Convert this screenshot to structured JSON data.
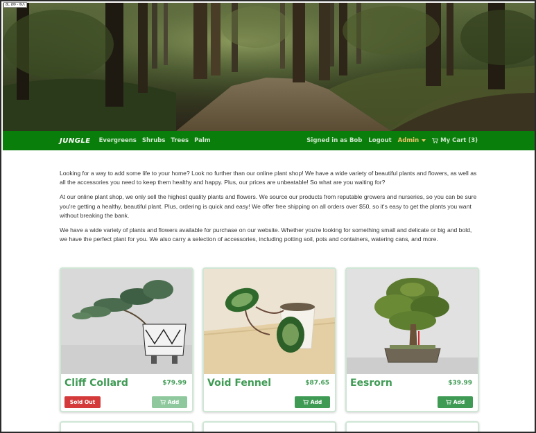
{
  "corner_tag": "ᏰᏞ ᏰᏫ - ᏫᏁ",
  "navbar": {
    "brand": "JUNGLE",
    "links": [
      "Evergreens",
      "Shrubs",
      "Trees",
      "Palm"
    ],
    "signed_in": "Signed in as Bob",
    "logout": "Logout",
    "admin": "Admin",
    "cart": "My Cart (3)",
    "cart_icon": "cart-icon"
  },
  "intro": {
    "p1": "Looking for a way to add some life to your home? Look no further than our online plant shop! We have a wide variety of beautiful plants and flowers, as well as all the accessories you need to keep them healthy and happy. Plus, our prices are unbeatable! So what are you waiting for?",
    "p2": "At our online plant shop, we only sell the highest quality plants and flowers. We source our products from reputable growers and nurseries, so you can be sure you're getting a healthy, beautiful plant. Plus, ordering is quick and easy! We offer free shipping on all orders over $50, so it's easy to get the plants you want without breaking the bank.",
    "p3": "We have a wide variety of plants and flowers available for purchase on our website. Whether you're looking for something small and delicate or big and bold, we have the perfect plant for you. We also carry a selection of accessories, including potting soil, pots and containers, watering cans, and more."
  },
  "products": [
    {
      "name": "Cliff Collard",
      "price": "$79.99",
      "sold_out": "Sold Out",
      "add": "Add"
    },
    {
      "name": "Void Fennel",
      "price": "$87.65",
      "add": "Add"
    },
    {
      "name": "Eesrorn",
      "price": "$39.99",
      "add": "Add"
    }
  ],
  "colors": {
    "nav_bg": "#0a7e0a",
    "accent_green": "#3f9b54",
    "sold_out_red": "#d43a3a",
    "admin_gold": "#f0c46a"
  }
}
